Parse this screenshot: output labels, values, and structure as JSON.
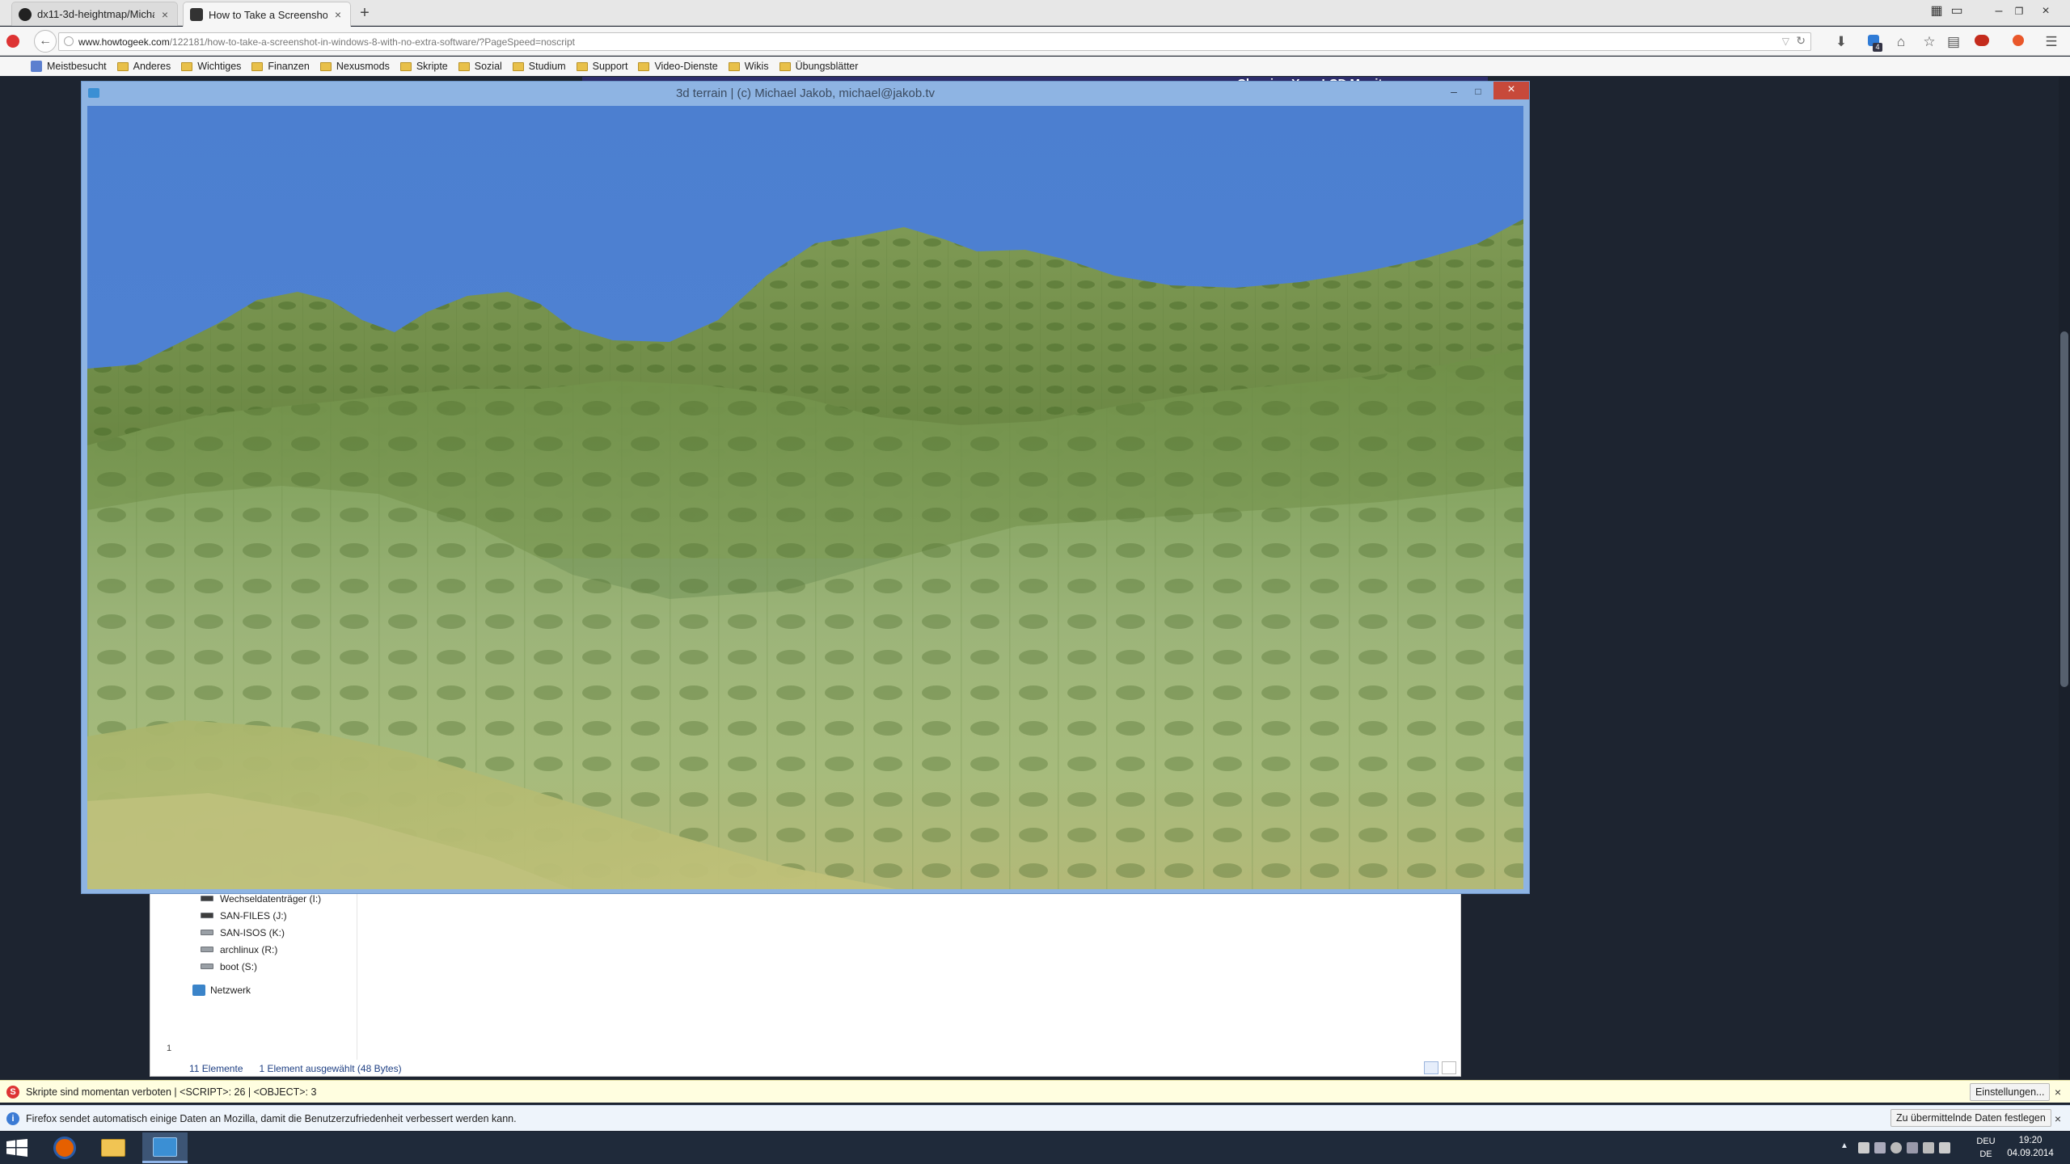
{
  "tabs": [
    {
      "label": "dx11-3d-heightmap/Micha...",
      "icon": "github-icon",
      "active": false
    },
    {
      "label": "How to Take a Screenshot i...",
      "icon": "htg-icon",
      "active": true
    }
  ],
  "url": {
    "host": "www.howtogeek.com",
    "path": "/122181/how-to-take-a-screenshot-in-windows-8-with-no-extra-software/?PageSpeed=noscript"
  },
  "bookmarks": [
    "Meistbesucht",
    "Anderes",
    "Wichtiges",
    "Finanzen",
    "Nexusmods",
    "Skripte",
    "Sozial",
    "Studium",
    "Support",
    "Video-Dienste",
    "Wikis",
    "Übungsblätter"
  ],
  "page_headline": "Cleaning Your LCD Monitor",
  "terrain_window": {
    "title": "3d terrain | (c) Michael Jakob, michael@jakob.tv"
  },
  "explorer": {
    "drives": [
      {
        "label": "Wechseldatenträger (I:)",
        "dark": true
      },
      {
        "label": "SAN-FILES (J:)",
        "dark": true
      },
      {
        "label": "SAN-ISOS (K:)",
        "dark": false
      },
      {
        "label": "archlinux (R:)",
        "dark": false
      },
      {
        "label": "boot (S:)",
        "dark": false
      }
    ],
    "network": "Netzwerk",
    "edge_char": "1",
    "status_count": "11 Elemente",
    "status_selected": "1 Element ausgewählt (48 Bytes)"
  },
  "notifications": {
    "script_block": "Skripte sind momentan verboten | <SCRIPT>: 26 | <OBJECT>: 3",
    "script_button": "Einstellungen...",
    "telemetry": "Firefox sendet automatisch einige Daten an Mozilla, damit die Benutzerzufriedenheit verbessert werden kann.",
    "telemetry_button": "Zu übermittelnde Daten festlegen"
  },
  "tray": {
    "lang_top": "DEU",
    "lang_bottom": "DE",
    "time": "19:20",
    "date": "04.09.2014",
    "badge": "4"
  },
  "colors": {
    "sky": "#4c7fd0",
    "grass_light": "#a8b877",
    "grass_dark": "#4c6d2b",
    "taskbar": "#1f2a3a",
    "close_red": "#c7493a"
  }
}
